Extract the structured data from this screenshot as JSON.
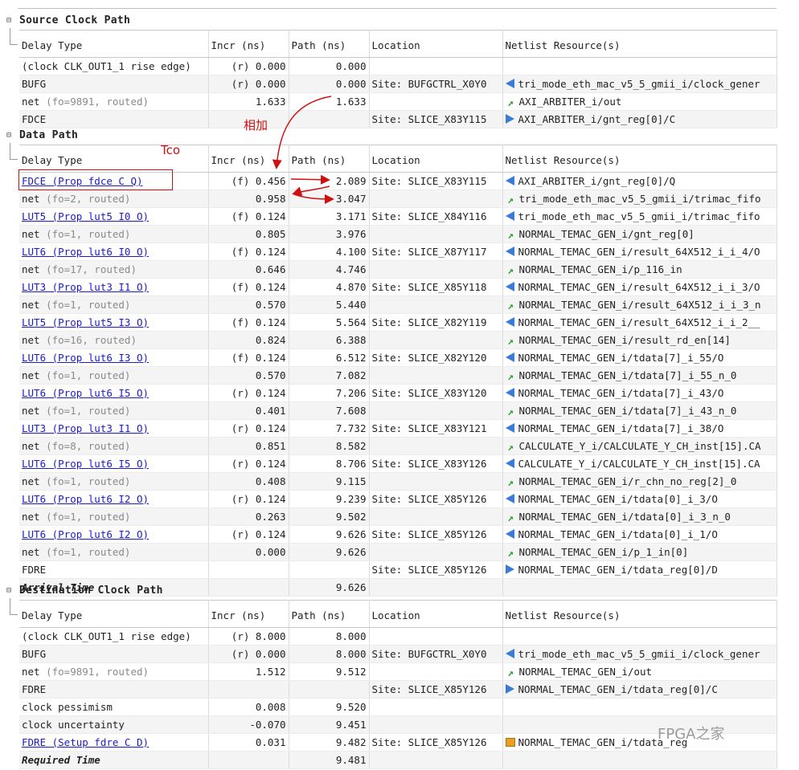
{
  "columns": {
    "delay_type": "Delay Type",
    "incr": "Incr (ns)",
    "path": "Path (ns)",
    "location": "Location",
    "netlist": "Netlist Resource(s)"
  },
  "source_clock": {
    "title": "Source Clock Path",
    "rows": [
      {
        "type": "(clock CLK_OUT1_1 rise edge)",
        "style": "plain",
        "incr": "(r) 0.000",
        "path": "0.000",
        "location": "",
        "icon": "",
        "netlist": ""
      },
      {
        "type": "BUFG",
        "style": "plain",
        "incr": "(r) 0.000",
        "path": "0.000",
        "location": "Site: BUFGCTRL_X0Y0",
        "icon": "port",
        "netlist": "tri_mode_eth_mac_v5_5_gmii_i/clock_gener"
      },
      {
        "type": "net (fo=9891, routed)",
        "style": "net",
        "incr": "1.633",
        "path": "1.633",
        "location": "",
        "icon": "net",
        "netlist": "AXI_ARBITER_i/out"
      },
      {
        "type": "FDCE",
        "style": "plain",
        "incr": "",
        "path": "",
        "location": "Site: SLICE_X83Y115",
        "icon": "pin",
        "netlist": "AXI_ARBITER_i/gnt_reg[0]/C"
      }
    ]
  },
  "data_path": {
    "title": "Data Path",
    "rows": [
      {
        "type": "FDCE (Prop fdce C Q)",
        "style": "link",
        "incr": "(f) 0.456",
        "path": "2.089",
        "location": "Site: SLICE_X83Y115",
        "icon": "port",
        "netlist": "AXI_ARBITER_i/gnt_reg[0]/Q"
      },
      {
        "type": "net (fo=2, routed)",
        "style": "net",
        "incr": "0.958",
        "path": "3.047",
        "location": "",
        "icon": "net",
        "netlist": "tri_mode_eth_mac_v5_5_gmii_i/trimac_fifo"
      },
      {
        "type": "LUT5 (Prop lut5 I0 O)",
        "style": "link",
        "incr": "(f) 0.124",
        "path": "3.171",
        "location": "Site: SLICE_X84Y116",
        "icon": "port",
        "netlist": "tri_mode_eth_mac_v5_5_gmii_i/trimac_fifo"
      },
      {
        "type": "net (fo=1, routed)",
        "style": "net",
        "incr": "0.805",
        "path": "3.976",
        "location": "",
        "icon": "net",
        "netlist": "NORMAL_TEMAC_GEN_i/gnt_reg[0]"
      },
      {
        "type": "LUT6 (Prop lut6 I0 O)",
        "style": "link",
        "incr": "(f) 0.124",
        "path": "4.100",
        "location": "Site: SLICE_X87Y117",
        "icon": "port",
        "netlist": "NORMAL_TEMAC_GEN_i/result_64X512_i_i_4/O"
      },
      {
        "type": "net (fo=17, routed)",
        "style": "net",
        "incr": "0.646",
        "path": "4.746",
        "location": "",
        "icon": "net",
        "netlist": "NORMAL_TEMAC_GEN_i/p_116_in"
      },
      {
        "type": "LUT3 (Prop lut3 I1 O)",
        "style": "link",
        "incr": "(f) 0.124",
        "path": "4.870",
        "location": "Site: SLICE_X85Y118",
        "icon": "port",
        "netlist": "NORMAL_TEMAC_GEN_i/result_64X512_i_i_3/O"
      },
      {
        "type": "net (fo=1, routed)",
        "style": "net",
        "incr": "0.570",
        "path": "5.440",
        "location": "",
        "icon": "net",
        "netlist": "NORMAL_TEMAC_GEN_i/result_64X512_i_i_3_n"
      },
      {
        "type": "LUT5 (Prop lut5 I3 O)",
        "style": "link",
        "incr": "(f) 0.124",
        "path": "5.564",
        "location": "Site: SLICE_X82Y119",
        "icon": "port",
        "netlist": "NORMAL_TEMAC_GEN_i/result_64X512_i_i_2__"
      },
      {
        "type": "net (fo=16, routed)",
        "style": "net",
        "incr": "0.824",
        "path": "6.388",
        "location": "",
        "icon": "net",
        "netlist": "NORMAL_TEMAC_GEN_i/result_rd_en[14]"
      },
      {
        "type": "LUT6 (Prop lut6 I3 O)",
        "style": "link",
        "incr": "(f) 0.124",
        "path": "6.512",
        "location": "Site: SLICE_X82Y120",
        "icon": "port",
        "netlist": "NORMAL_TEMAC_GEN_i/tdata[7]_i_55/O"
      },
      {
        "type": "net (fo=1, routed)",
        "style": "net",
        "incr": "0.570",
        "path": "7.082",
        "location": "",
        "icon": "net",
        "netlist": "NORMAL_TEMAC_GEN_i/tdata[7]_i_55_n_0"
      },
      {
        "type": "LUT6 (Prop lut6 I5 O)",
        "style": "link",
        "incr": "(r) 0.124",
        "path": "7.206",
        "location": "Site: SLICE_X83Y120",
        "icon": "port",
        "netlist": "NORMAL_TEMAC_GEN_i/tdata[7]_i_43/O"
      },
      {
        "type": "net (fo=1, routed)",
        "style": "net",
        "incr": "0.401",
        "path": "7.608",
        "location": "",
        "icon": "net",
        "netlist": "NORMAL_TEMAC_GEN_i/tdata[7]_i_43_n_0"
      },
      {
        "type": "LUT3 (Prop lut3 I1 O)",
        "style": "link",
        "incr": "(r) 0.124",
        "path": "7.732",
        "location": "Site: SLICE_X83Y121",
        "icon": "port",
        "netlist": "NORMAL_TEMAC_GEN_i/tdata[7]_i_38/O"
      },
      {
        "type": "net (fo=8, routed)",
        "style": "net",
        "incr": "0.851",
        "path": "8.582",
        "location": "",
        "icon": "net",
        "netlist": "CALCULATE_Y_i/CALCULATE_Y_CH_inst[15].CA"
      },
      {
        "type": "LUT6 (Prop lut6 I5 O)",
        "style": "link",
        "incr": "(r) 0.124",
        "path": "8.706",
        "location": "Site: SLICE_X83Y126",
        "icon": "port",
        "netlist": "CALCULATE_Y_i/CALCULATE_Y_CH_inst[15].CA"
      },
      {
        "type": "net (fo=1, routed)",
        "style": "net",
        "incr": "0.408",
        "path": "9.115",
        "location": "",
        "icon": "net",
        "netlist": "NORMAL_TEMAC_GEN_i/r_chn_no_reg[2]_0"
      },
      {
        "type": "LUT6 (Prop lut6 I2 O)",
        "style": "link",
        "incr": "(r) 0.124",
        "path": "9.239",
        "location": "Site: SLICE_X85Y126",
        "icon": "port",
        "netlist": "NORMAL_TEMAC_GEN_i/tdata[0]_i_3/O"
      },
      {
        "type": "net (fo=1, routed)",
        "style": "net",
        "incr": "0.263",
        "path": "9.502",
        "location": "",
        "icon": "net",
        "netlist": "NORMAL_TEMAC_GEN_i/tdata[0]_i_3_n_0"
      },
      {
        "type": "LUT6 (Prop lut6 I2 O)",
        "style": "link",
        "incr": "(r) 0.124",
        "path": "9.626",
        "location": "Site: SLICE_X85Y126",
        "icon": "port",
        "netlist": "NORMAL_TEMAC_GEN_i/tdata[0]_i_1/O"
      },
      {
        "type": "net (fo=1, routed)",
        "style": "net",
        "incr": "0.000",
        "path": "9.626",
        "location": "",
        "icon": "net",
        "netlist": "NORMAL_TEMAC_GEN_i/p_1_in[0]"
      },
      {
        "type": "FDRE",
        "style": "plain",
        "incr": "",
        "path": "",
        "location": "Site: SLICE_X85Y126",
        "icon": "pin",
        "netlist": "NORMAL_TEMAC_GEN_i/tdata_reg[0]/D"
      },
      {
        "type": "Arrival Time",
        "style": "total",
        "incr": "",
        "path": "9.626",
        "location": "",
        "icon": "",
        "netlist": ""
      }
    ]
  },
  "dest_clock": {
    "title": "Destination Clock Path",
    "rows": [
      {
        "type": "(clock CLK_OUT1_1 rise edge)",
        "style": "plain",
        "incr": "(r) 8.000",
        "path": "8.000",
        "location": "",
        "icon": "",
        "netlist": ""
      },
      {
        "type": "BUFG",
        "style": "plain",
        "incr": "(r) 0.000",
        "path": "8.000",
        "location": "Site: BUFGCTRL_X0Y0",
        "icon": "port",
        "netlist": "tri_mode_eth_mac_v5_5_gmii_i/clock_gener"
      },
      {
        "type": "net (fo=9891, routed)",
        "style": "net",
        "incr": "1.512",
        "path": "9.512",
        "location": "",
        "icon": "net",
        "netlist": "NORMAL_TEMAC_GEN_i/out"
      },
      {
        "type": "FDRE",
        "style": "plain",
        "incr": "",
        "path": "",
        "location": "Site: SLICE_X85Y126",
        "icon": "pin",
        "netlist": "NORMAL_TEMAC_GEN_i/tdata_reg[0]/C"
      },
      {
        "type": "clock pessimism",
        "style": "plain",
        "incr": "0.008",
        "path": "9.520",
        "location": "",
        "icon": "",
        "netlist": ""
      },
      {
        "type": "clock uncertainty",
        "style": "plain",
        "incr": "-0.070",
        "path": "9.451",
        "location": "",
        "icon": "",
        "netlist": ""
      },
      {
        "type": "FDRE (Setup fdre C D)",
        "style": "link",
        "incr": "0.031",
        "path": "9.482",
        "location": "Site: SLICE_X85Y126",
        "icon": "cell",
        "netlist": "NORMAL_TEMAC_GEN_i/tdata_reg"
      },
      {
        "type": "Required Time",
        "style": "total",
        "incr": "",
        "path": "9.481",
        "location": "",
        "icon": "",
        "netlist": ""
      }
    ]
  },
  "annotations": {
    "tco": "Tco",
    "add": "相加",
    "watermark": "FPGA之家",
    "annotation_color": "#d01010"
  }
}
